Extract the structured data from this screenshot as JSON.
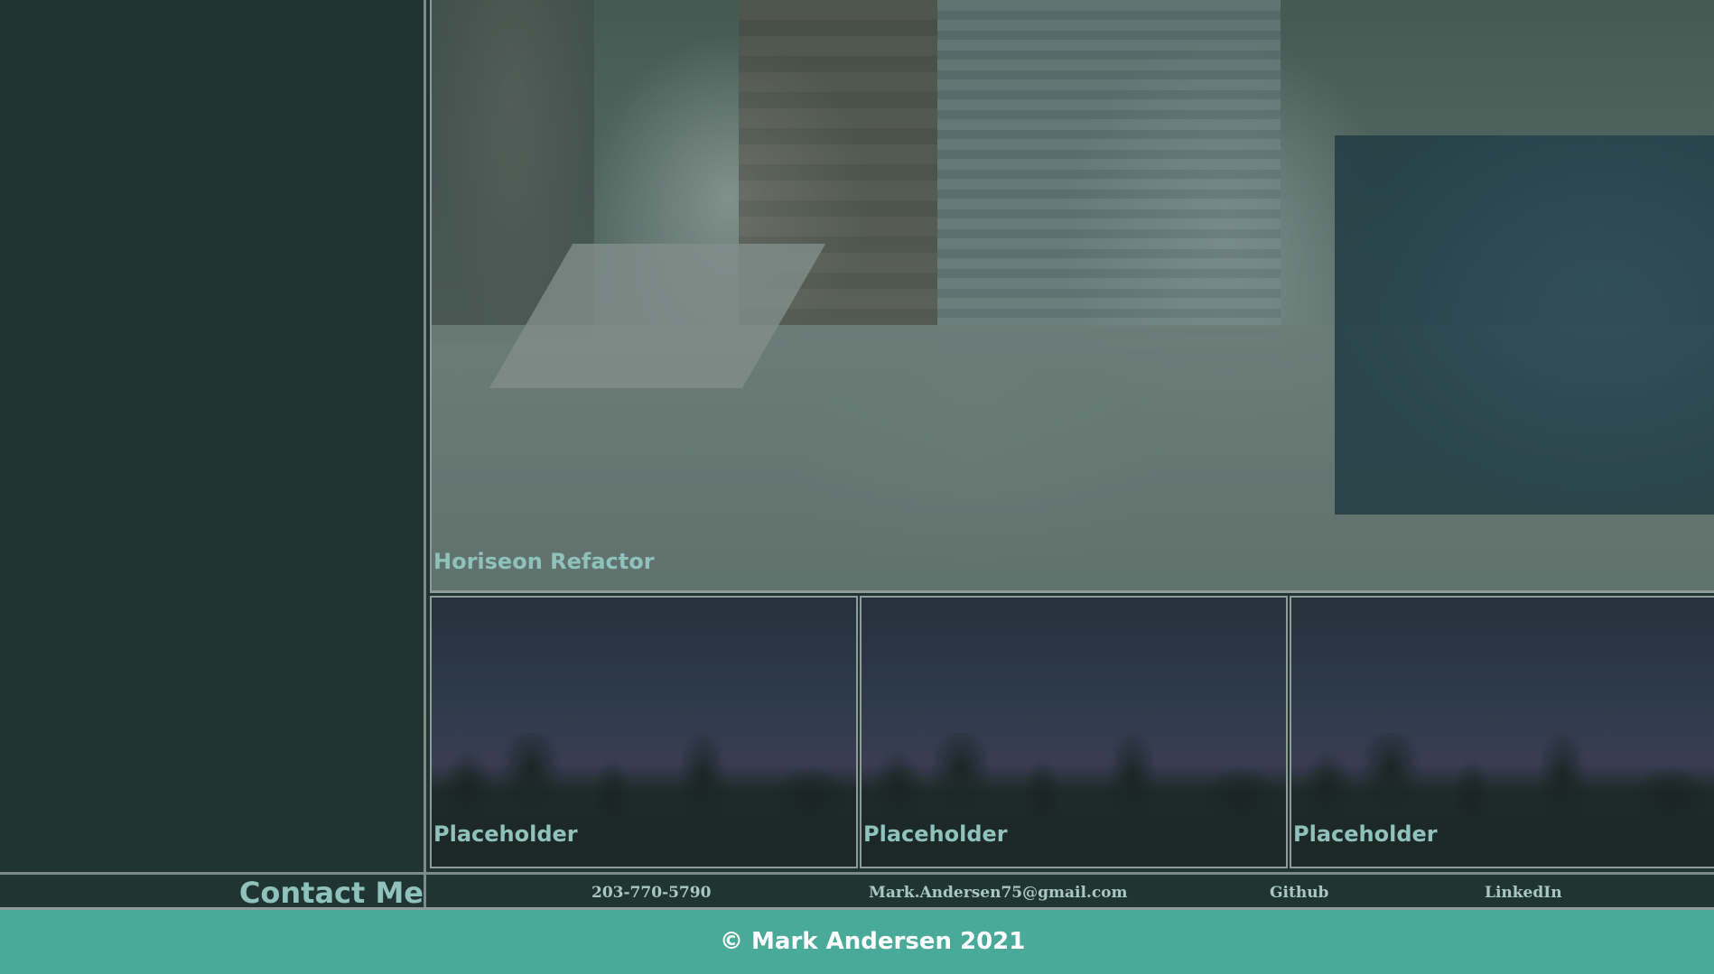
{
  "hero": {
    "title": "Horiseon Refactor"
  },
  "cards": [
    {
      "title": "Placeholder"
    },
    {
      "title": "Placeholder"
    },
    {
      "title": "Placeholder"
    }
  ],
  "contact": {
    "heading": "Contact Me",
    "phone": "203-770-5790",
    "email": "Mark.Andersen75@gmail.com",
    "github": "Github",
    "linkedin": "LinkedIn"
  },
  "footer": {
    "copyright": "© Mark Andersen 2021"
  },
  "colors": {
    "accent": "#8fc1bd",
    "background": "#203531",
    "footer": "#4aaa9a"
  }
}
